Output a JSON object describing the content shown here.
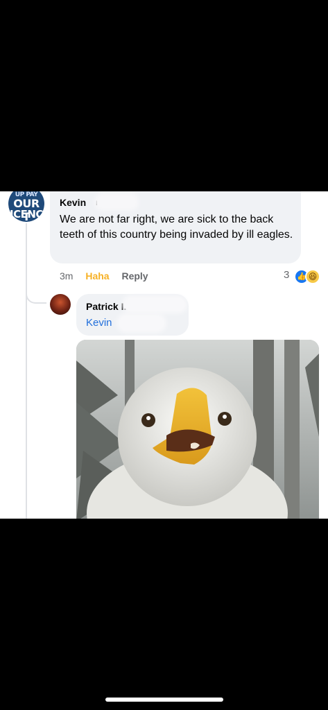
{
  "comment1": {
    "avatar_text": [
      "UP PAY",
      "OUR T",
      "ICENC"
    ],
    "author": "Kevin",
    "author_tail": "r",
    "text": "We are not far right, we are sick to the back teeth of this country being invaded by ill eagles.",
    "time": "3m",
    "reaction_action": "Haha",
    "reply_label": "Reply",
    "reaction_count": "3",
    "reaction_icons": [
      "like-icon",
      "haha-icon"
    ]
  },
  "comment2": {
    "author": "Patrick I.",
    "tag": "Kevin",
    "attachment": "bald-eagle-gif"
  },
  "colors": {
    "bubble": "#f0f2f5",
    "link_blue": "#216fdb",
    "haha_yellow": "#f7b125",
    "like_blue": "#1877f2"
  }
}
